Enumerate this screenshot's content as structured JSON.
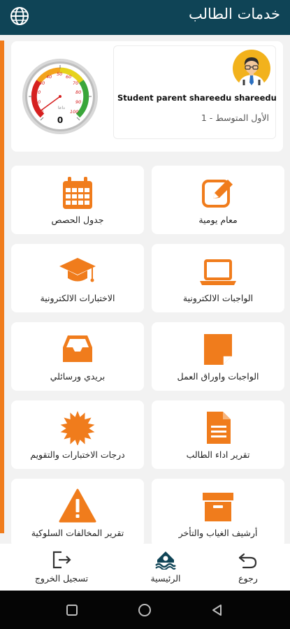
{
  "header": {
    "title": "خدمات الطالب",
    "globe_icon": "globe-icon"
  },
  "profile": {
    "name": "Student parent shareedu shareedu",
    "class": "الأول المتوسط - 1",
    "gauge": {
      "value": 0,
      "labels": [
        "0",
        "10",
        "20",
        "30",
        "40",
        "50",
        "60",
        "70",
        "80",
        "90",
        "100"
      ],
      "unit": "داعا"
    }
  },
  "accent": "#f07c1c",
  "tiles": [
    {
      "label": "معام يومية",
      "icon": "edit-icon"
    },
    {
      "label": "جدول الحصص",
      "icon": "calendar-icon"
    },
    {
      "label": "الواجبات الالكترونية",
      "icon": "laptop-icon"
    },
    {
      "label": "الاختبارات الالكترونية",
      "icon": "graduation-cap-icon"
    },
    {
      "label": "الواجبات واوراق العمل",
      "icon": "sticky-note-icon"
    },
    {
      "label": "بريدي ورسائلي",
      "icon": "inbox-icon"
    },
    {
      "label": "تقرير اداء الطالب",
      "icon": "document-icon"
    },
    {
      "label": "درجات الاختبارات والتقويم",
      "icon": "badge-icon"
    },
    {
      "label": "أرشيف الغياب والتأخر",
      "icon": "archive-box-icon"
    },
    {
      "label": "تقرير المخالفات السلوكية",
      "icon": "warning-icon"
    }
  ],
  "bottom_nav": {
    "back": "رجوع",
    "home": "الرئيسية",
    "logout": "تسجيل الخروج"
  }
}
